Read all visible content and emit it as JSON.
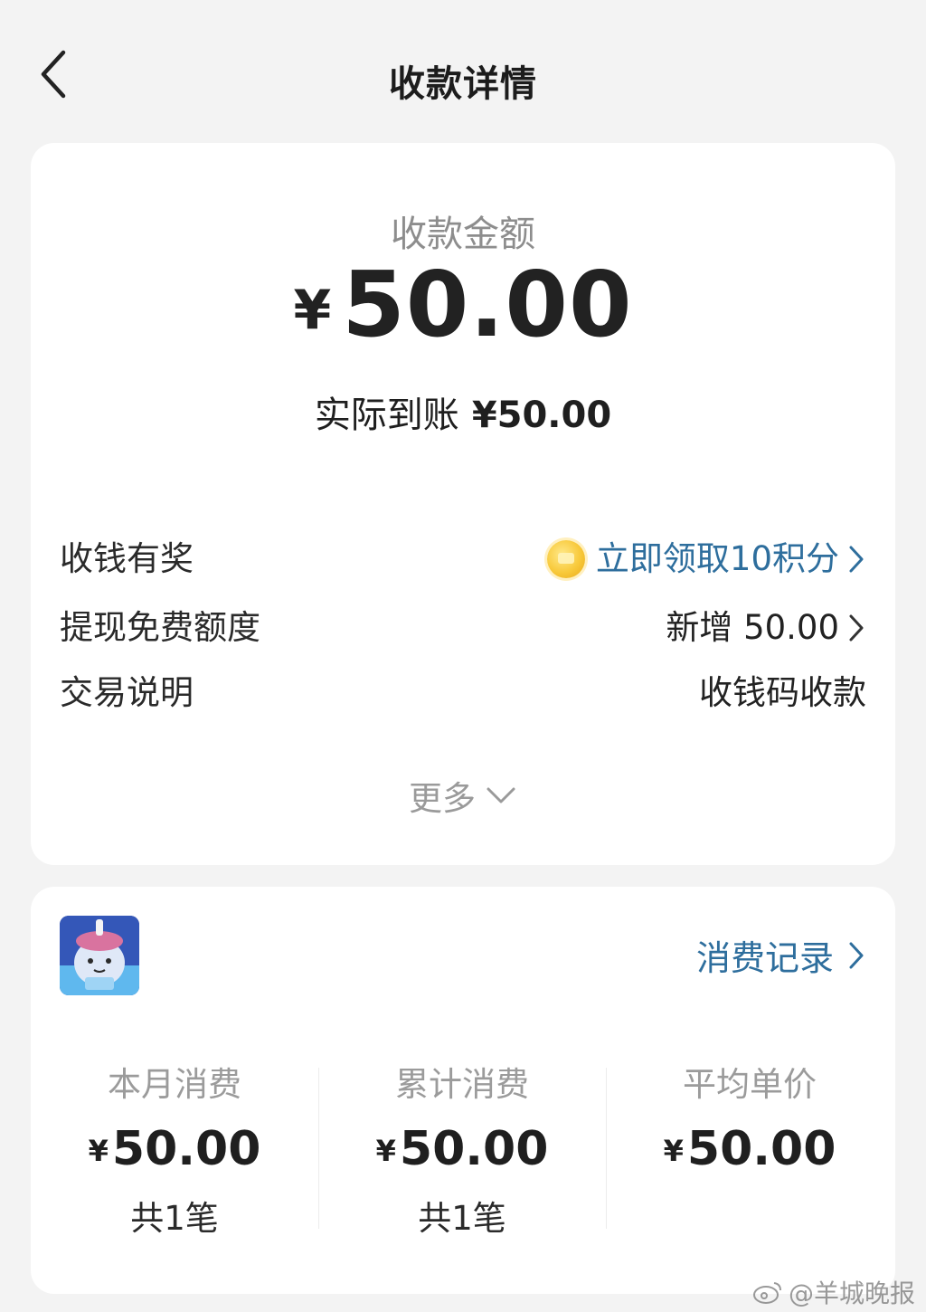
{
  "header": {
    "title": "收款详情"
  },
  "summary": {
    "amount_label": "收款金额",
    "currency": "¥",
    "amount": "50.00",
    "actual_label": "实际到账",
    "actual_value": "¥50.00"
  },
  "details": [
    {
      "label": "收钱有奖",
      "value": "立即领取10积分",
      "icon": "gold-coin-icon",
      "link": true,
      "accent": "#2e6e9d"
    },
    {
      "label": "提现免费额度",
      "value": "新增 50.00",
      "link": true
    },
    {
      "label": "交易说明",
      "value": "收钱码收款",
      "link": false
    }
  ],
  "more_label": "更多",
  "customer": {
    "records_label": "消费记录",
    "stats": [
      {
        "label": "本月消费",
        "currency": "¥",
        "amount": "50.00",
        "count": "共1笔"
      },
      {
        "label": "累计消费",
        "currency": "¥",
        "amount": "50.00",
        "count": "共1笔"
      },
      {
        "label": "平均单价",
        "currency": "¥",
        "amount": "50.00",
        "count": ""
      }
    ]
  },
  "watermark": "@羊城晚报",
  "colors": {
    "background": "#f3f3f3",
    "card": "#ffffff",
    "link_blue": "#2e6e9d",
    "muted_text": "#9b9b9b"
  }
}
